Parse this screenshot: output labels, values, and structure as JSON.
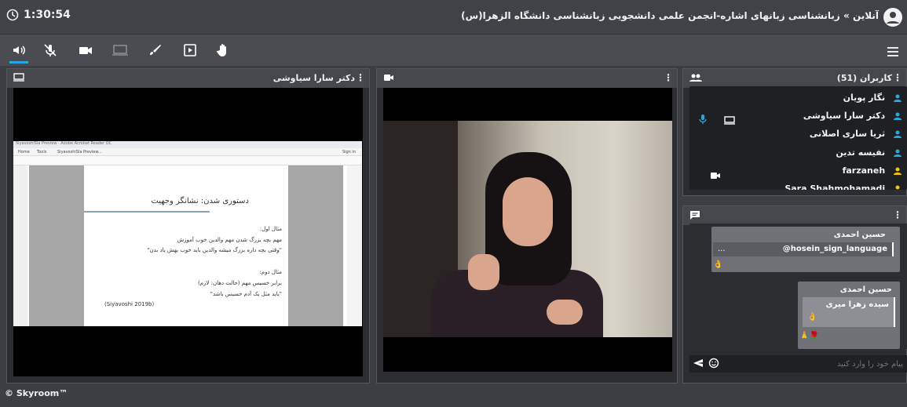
{
  "header": {
    "timer": "1:30:54",
    "title": "آنلاین » زبانشناسی زبانهای اشاره-انجمن علمی دانشجویی زبانشناسی دانشگاه الزهرا(س)"
  },
  "toolbar": {
    "buttons": [
      "speaker-icon",
      "mic-off-icon",
      "camera-icon",
      "screen-share-icon",
      "brush-icon",
      "play-icon",
      "raise-hand-icon"
    ],
    "active": "speaker-icon"
  },
  "presenter_panel": {
    "title": "دکتر سارا سیاوشی",
    "slide": {
      "heading": "دستوری شدن: نشانگر وجهیت",
      "example1_label": "مثال اول:",
      "example1_line1": "مهم  بچه  بزرگ شدن  مهم  والدین  خوب  آموزش",
      "example1_line2": "\"وقتی بچه داره بزرگ میشه والدین باید خوب بهش یاد بدن\"",
      "example2_label": "مثال دوم:",
      "example2_line1": "برابر خسیس مهم (حالت دهان: لازم)",
      "example2_line2": "\"باید مثل یک آدم خسیس باشد\"",
      "citation": "(Siyavoshi 2019b)",
      "viewer_sign_in": "Sign in",
      "viewer_tabs": [
        "Home",
        "Tools",
        "SiyavoshiSla Preview..."
      ]
    }
  },
  "users_panel": {
    "title": "کاربران (51)",
    "users": [
      {
        "name": "نگار پویان",
        "role_color": "#29a8e0",
        "mic": false,
        "screen": false,
        "cam": false
      },
      {
        "name": "دکتر سارا سیاوشی",
        "role_color": "#29a8e0",
        "mic": true,
        "screen": true,
        "cam": false
      },
      {
        "name": "ثریا ساری اصلانی",
        "role_color": "#29a8e0",
        "mic": false,
        "screen": false,
        "cam": false
      },
      {
        "name": "نفیسه تدین",
        "role_color": "#29a8e0",
        "mic": false,
        "screen": false,
        "cam": false
      },
      {
        "name": "farzaneh",
        "role_color": "#f2c40f",
        "mic": false,
        "screen": false,
        "cam": true
      },
      {
        "name": "Sara Shahmohamadi",
        "role_color": "#f2c40f",
        "mic": false,
        "screen": false,
        "cam": false
      }
    ]
  },
  "chat_panel": {
    "messages": [
      {
        "sender": "حسین احمدی",
        "text": "hosein_sign_language@",
        "ellipsis": "...",
        "emoji": "👌"
      },
      {
        "sender": "حسین احمدی",
        "quote_text": "سیده زهرا میری",
        "quote_emoji": "👌",
        "emoji": "🌹🙏"
      }
    ],
    "input_placeholder": "پیام خود را وارد کنید"
  },
  "footer": {
    "brand": "© Skyroom™"
  }
}
